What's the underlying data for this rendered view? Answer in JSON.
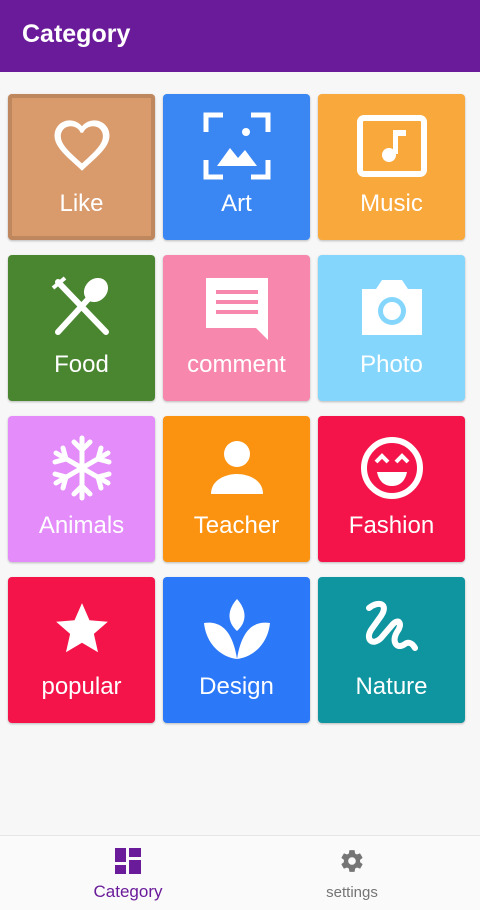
{
  "appbar": {
    "title": "Category",
    "color": "#6a1b9a"
  },
  "tiles": [
    {
      "label": "Like",
      "icon": "heart-icon",
      "color": "#d99a6c"
    },
    {
      "label": "Art",
      "icon": "image-icon",
      "color": "#3a87f3"
    },
    {
      "label": "Music",
      "icon": "music-note-icon",
      "color": "#f9a83b"
    },
    {
      "label": "Food",
      "icon": "restaurant-icon",
      "color": "#4a8530"
    },
    {
      "label": "comment",
      "icon": "comment-icon",
      "color": "#f787ac"
    },
    {
      "label": "Photo",
      "icon": "camera-icon",
      "color": "#84d6fd"
    },
    {
      "label": "Animals",
      "icon": "snowflake-icon",
      "color": "#e38cfa"
    },
    {
      "label": "Teacher",
      "icon": "person-icon",
      "color": "#fb9210"
    },
    {
      "label": "Fashion",
      "icon": "smiley-icon",
      "color": "#f41449"
    },
    {
      "label": "popular",
      "icon": "star-icon",
      "color": "#f41449"
    },
    {
      "label": "Design",
      "icon": "lotus-icon",
      "color": "#2b78f9"
    },
    {
      "label": "Nature",
      "icon": "gesture-icon",
      "color": "#0f95a0"
    }
  ],
  "bottom_nav": {
    "items": [
      {
        "label": "Category",
        "icon": "dashboard-icon",
        "active": true
      },
      {
        "label": "settings",
        "icon": "gear-icon",
        "active": false
      }
    ]
  }
}
